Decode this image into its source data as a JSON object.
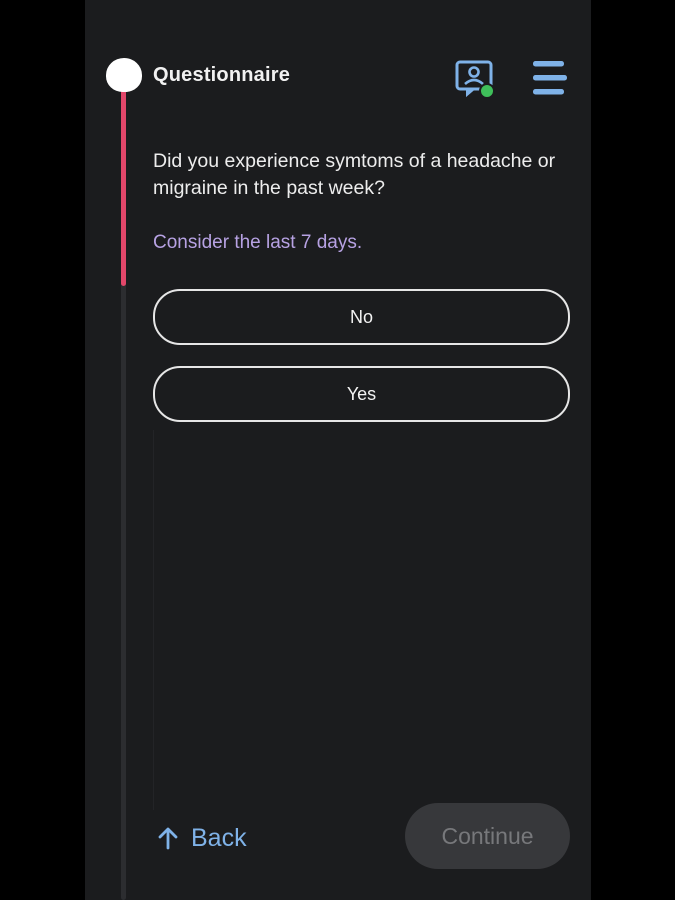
{
  "header": {
    "title": "Questionnaire"
  },
  "icons": {
    "consult": "video-consult-icon",
    "menu": "hamburger-menu-icon",
    "back": "arrow-up-icon"
  },
  "progress": {
    "fraction": 0.26
  },
  "question": {
    "text": "Did you experience symtoms of a headache or migraine in the past week?",
    "hint": "Consider the last 7 days."
  },
  "options": [
    {
      "label": "No"
    },
    {
      "label": "Yes"
    }
  ],
  "footer": {
    "back_label": "Back",
    "continue_label": "Continue"
  },
  "colors": {
    "background": "#1b1c1e",
    "progress_accent": "#e2476a",
    "hint": "#b7a2e3",
    "link": "#7fb2e8",
    "status_online": "#3fbf5a",
    "icon_accent": "#7fb2e8"
  }
}
